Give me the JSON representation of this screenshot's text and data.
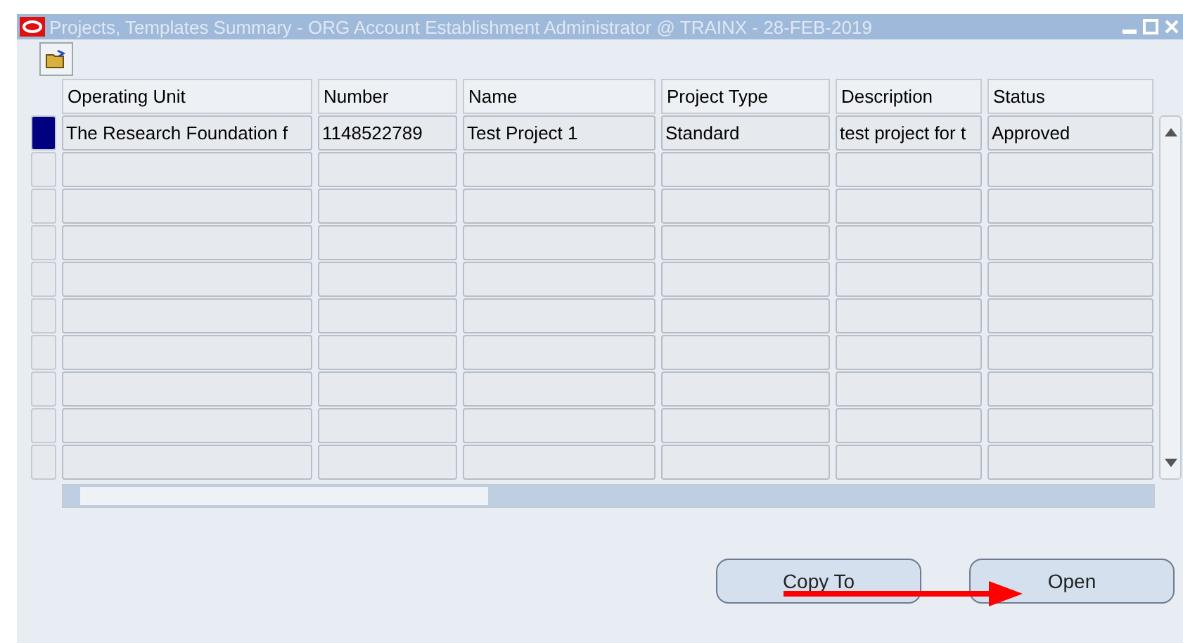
{
  "window": {
    "title": "Projects, Templates Summary - ORG Account Establishment Administrator @ TRAINX - 28-FEB-2019"
  },
  "table": {
    "columns": [
      "Operating Unit",
      "Number",
      "Name",
      "Project Type",
      "Description",
      "Status"
    ],
    "rows": [
      {
        "selected": true,
        "cells": [
          "The Research Foundation f",
          "1148522789",
          "Test Project 1",
          "Standard",
          "test project for t",
          "Approved"
        ]
      },
      {
        "selected": false
      },
      {
        "selected": false
      },
      {
        "selected": false
      },
      {
        "selected": false
      },
      {
        "selected": false
      },
      {
        "selected": false
      },
      {
        "selected": false
      },
      {
        "selected": false
      },
      {
        "selected": false
      }
    ]
  },
  "buttons": [
    {
      "label": "Copy To"
    },
    {
      "label": "Open"
    }
  ]
}
